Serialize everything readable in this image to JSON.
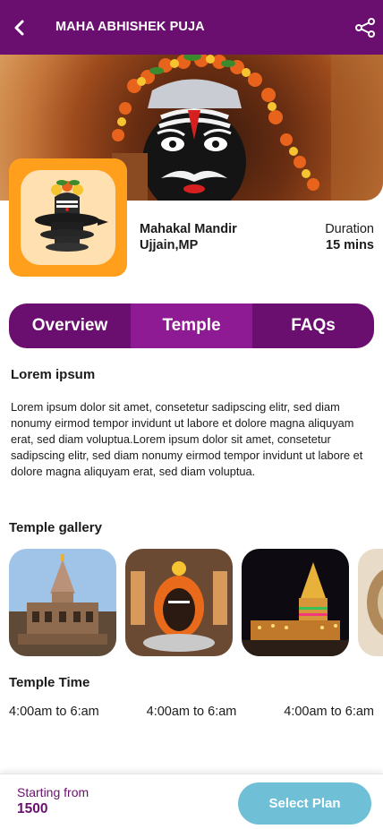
{
  "header": {
    "title": "MAHA ABHISHEK PUJA",
    "back_icon": "chevron-left-icon",
    "share_icon": "share-icon"
  },
  "temple": {
    "name_line1": "Mahakal Mandir",
    "name_line2": "Ujjain,MP"
  },
  "duration": {
    "label": "Duration",
    "value": "15 mins"
  },
  "tabs": [
    {
      "label": "Overview",
      "active": false
    },
    {
      "label": "Temple",
      "active": true
    },
    {
      "label": "FAQs",
      "active": false
    }
  ],
  "content": {
    "heading": "Lorem ipsum",
    "body": "Lorem ipsum dolor sit amet, consetetur sadipscing elitr, sed diam nonumy eirmod tempor invidunt ut labore et dolore magna aliquyam erat, sed diam voluptua.Lorem ipsum dolor sit amet, consetetur sadipscing elitr, sed diam nonumy eirmod tempor invidunt ut labore et dolore magna aliquyam erat, sed diam voluptua."
  },
  "gallery": {
    "heading": "Temple gallery"
  },
  "timings": {
    "heading": "Temple Time",
    "slots": [
      "4:00am to 6:am",
      "4:00am to 6:am",
      "4:00am to 6:am"
    ]
  },
  "footer": {
    "starting_label": "Starting from",
    "price": "1500",
    "select_button": "Select Plan"
  },
  "colors": {
    "primary": "#6a0f6f",
    "tab_active": "#8e1a94",
    "accent_orange": "#ff9f1c",
    "button": "#6fc0d6"
  }
}
